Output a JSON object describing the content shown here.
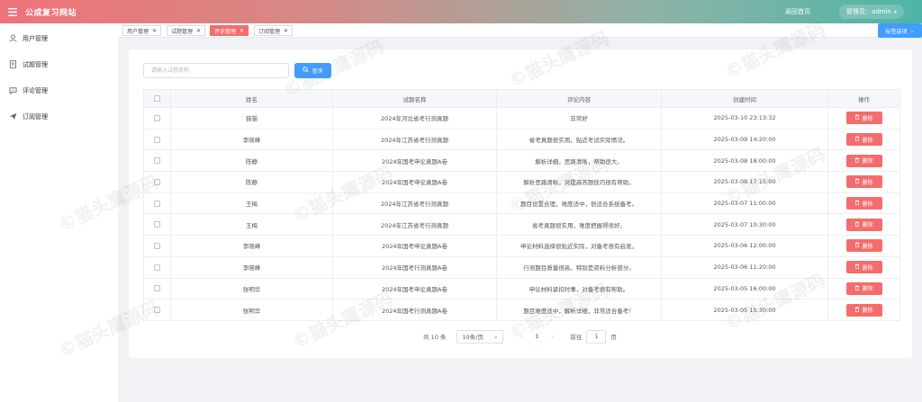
{
  "header": {
    "menu_icon": "menu-toggle-icon",
    "title": "公成复习网站",
    "home_link": "返回首页",
    "user_label": "管理员：admin"
  },
  "sidebar": {
    "items": [
      {
        "label": "用户管理",
        "icon": "user-icon"
      },
      {
        "label": "试题管理",
        "icon": "document-icon"
      },
      {
        "label": "评论管理",
        "icon": "comment-icon"
      },
      {
        "label": "订阅管理",
        "icon": "send-icon"
      }
    ]
  },
  "tabs": {
    "items": [
      {
        "label": "用户管理",
        "active": false
      },
      {
        "label": "试题管理",
        "active": false
      },
      {
        "label": "评论管理",
        "active": true
      },
      {
        "label": "订阅管理",
        "active": false
      }
    ],
    "options_label": "标签选项"
  },
  "search": {
    "placeholder": "请输入试卷名称",
    "button_label": "查询"
  },
  "table": {
    "columns": [
      "姓名",
      "试题名称",
      "评论内容",
      "创建时间",
      "操作"
    ],
    "delete_label": "删除",
    "rows": [
      {
        "name": "猫猫",
        "exam": "2024年河北省考行测真题",
        "comment": "非常好",
        "created": "2025-03-10 23:13:32"
      },
      {
        "name": "李晓峰",
        "exam": "2024年江苏省考行测真题",
        "comment": "省考真题很实用，贴近考试实际情况。",
        "created": "2025-03-09 14:20:00"
      },
      {
        "name": "陈静",
        "exam": "2024年国考申论真题A卷",
        "comment": "解析详细，思路清晰，帮助很大。",
        "created": "2025-03-08 18:00:00"
      },
      {
        "name": "陈静",
        "exam": "2024年国考申论真题A卷",
        "comment": "解析思路清晰，对提高答题技巧很有帮助。",
        "created": "2025-03-08 17:15:00"
      },
      {
        "name": "王梅",
        "exam": "2024年江苏省考行测真题",
        "comment": "题目设置合理，难度适中，很适合系统备考。",
        "created": "2025-03-07 11:00:00"
      },
      {
        "name": "王梅",
        "exam": "2024年江苏省考行测真题",
        "comment": "省考真题很实用，难度把握得很好。",
        "created": "2025-03-07 10:30:00"
      },
      {
        "name": "李晓峰",
        "exam": "2024年国考申论真题A卷",
        "comment": "申论材料选择很贴近实际，对备考很有启发。",
        "created": "2025-03-06 12:00:00"
      },
      {
        "name": "李晓峰",
        "exam": "2024年国考行测真题A卷",
        "comment": "行测题目质量很高，特别是资料分析部分。",
        "created": "2025-03-06 11:20:00"
      },
      {
        "name": "张明华",
        "exam": "2024年国考申论真题A卷",
        "comment": "申论材料紧扣时事，对备考很有帮助。",
        "created": "2025-03-05 16:00:00"
      },
      {
        "name": "张明华",
        "exam": "2024年国考行测真题A卷",
        "comment": "题目难度适中，解析详细，非常适合备考！",
        "created": "2025-03-05 15:30:00"
      }
    ]
  },
  "pagination": {
    "total": "共 10 条",
    "page_size": "10条/页",
    "prev": "‹",
    "current_page": "1",
    "next": "›",
    "goto_label": "前往",
    "goto_value": "1",
    "page_unit": "页"
  },
  "colors": {
    "primary": "#409eff",
    "danger": "#f56c6c"
  }
}
